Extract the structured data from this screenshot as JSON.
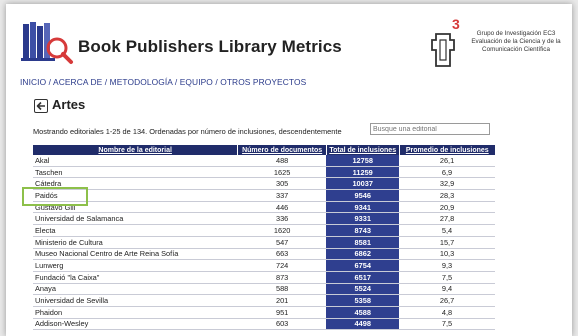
{
  "site": {
    "title": "Book Publishers Library Metrics",
    "group_text": [
      "Grupo de Investigación EC3",
      "Evaluación de la Ciencia y de la",
      "Comunicación Científica"
    ],
    "group_mark": "3"
  },
  "nav": [
    "INICIO",
    "ACERCA DE",
    "METODOLOGÍA",
    "EQUIPO",
    "OTROS PROYECTOS"
  ],
  "nav_separator": " / ",
  "section": {
    "title": "Artes",
    "back_icon": "arrow-left-icon"
  },
  "summary": "Mostrando editoriales 1-25 de 134. Ordenadas por número de inclusiones, descendentemente",
  "search": {
    "placeholder": "Busque una editorial"
  },
  "table": {
    "headers": [
      "Nombre de la editorial",
      "Número de documentos",
      "Total de inclusiones",
      "Promedio de inclusiones"
    ],
    "rows": [
      [
        "Akal",
        "488",
        "12758",
        "26,1"
      ],
      [
        "Taschen",
        "1625",
        "11259",
        "6,9"
      ],
      [
        "Cátedra",
        "305",
        "10037",
        "32,9"
      ],
      [
        "Paidós",
        "337",
        "9546",
        "28,3"
      ],
      [
        "Gustavo Gili",
        "446",
        "9341",
        "20,9"
      ],
      [
        "Universidad de Salamanca",
        "336",
        "9331",
        "27,8"
      ],
      [
        "Electa",
        "1620",
        "8743",
        "5,4"
      ],
      [
        "Ministerio de Cultura",
        "547",
        "8581",
        "15,7"
      ],
      [
        "Museo Nacional Centro de Arte Reina Sofía",
        "663",
        "6862",
        "10,3"
      ],
      [
        "Lunwerg",
        "724",
        "6754",
        "9,3"
      ],
      [
        "Fundació \"la Caixa\"",
        "873",
        "6517",
        "7,5"
      ],
      [
        "Anaya",
        "588",
        "5524",
        "9,4"
      ],
      [
        "Universidad de Sevilla",
        "201",
        "5358",
        "26,7"
      ],
      [
        "Phaidon",
        "951",
        "4588",
        "4,8"
      ],
      [
        "Addison-Wesley",
        "603",
        "4498",
        "7,5"
      ]
    ]
  },
  "colors": {
    "header_bg": "#202c6a",
    "total_col_bg": "#2f3f8f",
    "highlight_border": "#8dc04a",
    "nav_text": "#2a3a8a"
  }
}
